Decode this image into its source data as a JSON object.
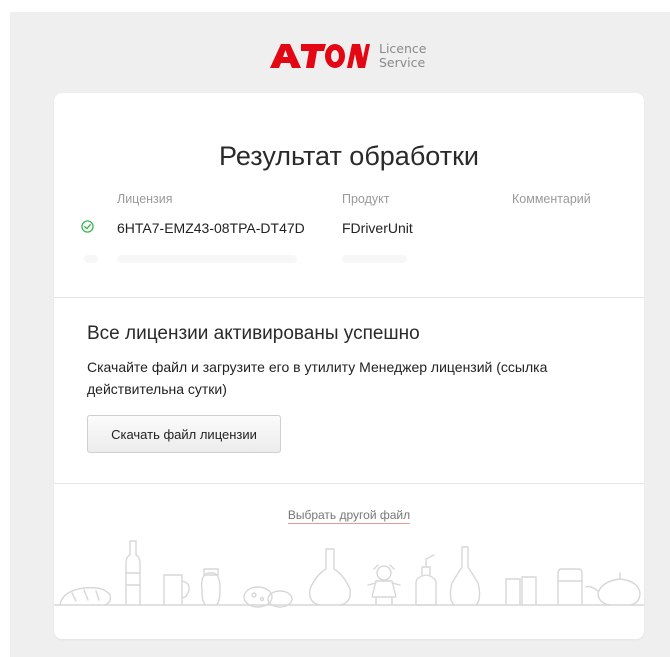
{
  "header": {
    "logo_text": "ATON",
    "logo_line1": "Licence",
    "logo_line2": "Service",
    "brand_color": "#e30613"
  },
  "result": {
    "title": "Результат обработки",
    "columns": {
      "license": "Лицензия",
      "product": "Продукт",
      "comment": "Комментарий"
    },
    "rows": [
      {
        "status_icon": "check-circle-icon",
        "status_color": "#2fb344",
        "license": "6HTA7-EMZ43-08TPA-DT47D",
        "product": "FDriverUnit",
        "comment": ""
      }
    ]
  },
  "success": {
    "heading": "Все лицензии активированы успешно",
    "description": "Скачайте файл и загрузите его в утилиту Менеджер лицензий (ссылка действительна сутки)",
    "download_button": "Скачать файл лицензии"
  },
  "footer": {
    "choose_other_file": "Выбрать другой файл",
    "illustration_icon": "goods-line-art-icon"
  }
}
